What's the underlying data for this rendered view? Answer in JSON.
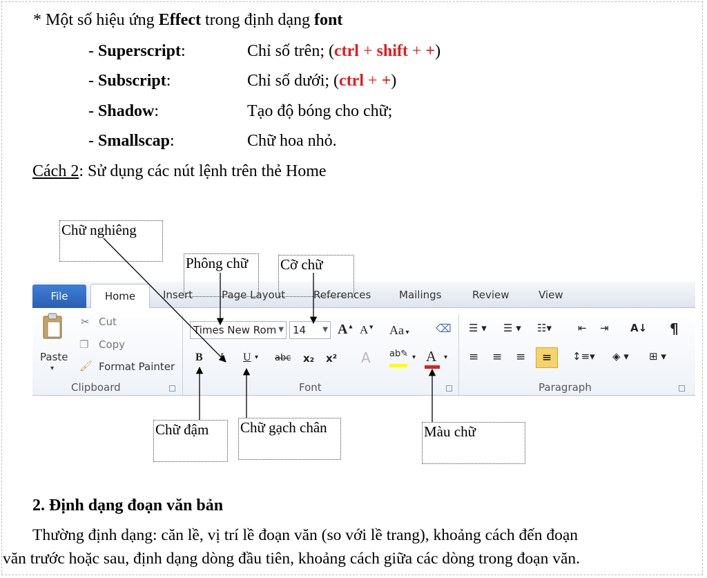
{
  "effects": {
    "heading_prefix": "* Một số hiệu ứng ",
    "heading_bold1": "Effect",
    "heading_mid": " trong định dạng ",
    "heading_bold2": "font",
    "items": [
      {
        "dash": "- ",
        "name": "Superscript",
        "colon": ":",
        "desc": "Chỉ số trên; (",
        "k1": "ctrl",
        "plus1": " + ",
        "k2": "shift",
        "plus2": " + ",
        "k3": "+",
        "close": ")"
      },
      {
        "dash": "- ",
        "name": "Subscript",
        "colon": ":",
        "desc": "Chỉ số dưới; (",
        "k1": "ctrl",
        "plus1": " + ",
        "k2": "+",
        "close": ")"
      },
      {
        "dash": "- ",
        "name": "Shadow",
        "colon": ":",
        "desc": "Tạo độ bóng cho chữ;"
      },
      {
        "dash": "- ",
        "name": "Smallscap",
        "colon": ":",
        "desc": "Chữ hoa nhỏ."
      }
    ]
  },
  "method2": {
    "label": "Cách 2",
    "text": ": Sử dụng các nút lệnh trên thẻ Home"
  },
  "annotations": {
    "italic": "Chữ nghiêng",
    "font_name": "Phông chữ",
    "font_size": "Cỡ chữ",
    "bold": "Chữ đậm",
    "underline": "Chữ gạch chân",
    "font_color": "Màu chữ"
  },
  "ribbon": {
    "tabs": {
      "file": "File",
      "home": "Home",
      "insert": "Insert",
      "page_layout": "Page Layout",
      "references": "References",
      "mailings": "Mailings",
      "review": "Review",
      "view": "View"
    },
    "clipboard": {
      "paste": "Paste",
      "cut": "Cut",
      "copy": "Copy",
      "format_painter": "Format Painter",
      "group": "Clipboard"
    },
    "font": {
      "name": "Times New Rom",
      "size": "14",
      "bold": "B",
      "italic": "I",
      "underline": "U",
      "strike": "abc",
      "subscript": "x₂",
      "superscript": "x²",
      "change_case": "Aa",
      "group": "Font"
    },
    "paragraph": {
      "group": "Paragraph",
      "sort": "A↓",
      "pilcrow": "¶"
    },
    "colors": {
      "file_tab": "#2a5fb4",
      "font_color_bar": "#e31b1b",
      "highlight_bar": "#ffff00"
    }
  },
  "section2": {
    "heading": "2. Định dạng đoạn văn bản",
    "para_line1": "Thường định dạng: căn lề, vị trí lề đoạn văn (so với lề trang), khoảng cách đến đoạn",
    "para_line2": "văn trước hoặc sau, định dạng dòng đầu tiên, khoảng cách giữa các dòng trong đoạn văn."
  }
}
